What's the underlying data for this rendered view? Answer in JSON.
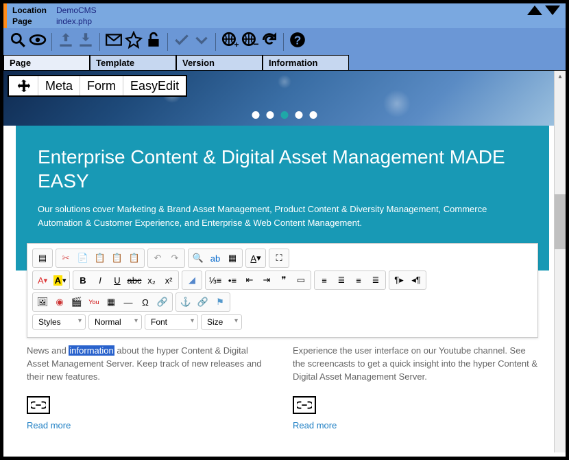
{
  "topbar": {
    "location_label": "Location",
    "location_value": "DemoCMS",
    "page_label": "Page",
    "page_value": "index.php"
  },
  "tabs": [
    "Page",
    "Template",
    "Version",
    "Information"
  ],
  "active_tab": 0,
  "page_tabs": {
    "meta": "Meta",
    "form": "Form",
    "easyedit": "EasyEdit"
  },
  "hero": {
    "dots": 5,
    "active_dot": 2
  },
  "teal": {
    "title": "Enterprise Content & Digital Asset Management MADE EASY",
    "body": "Our solutions cover Marketing & Brand Asset Management, Product Content & Diversity Management, Commerce Automation & Customer Experience, and Enterprise & Web Content Management."
  },
  "editor_dropdowns": {
    "styles": "Styles",
    "format": "Normal",
    "font": "Font",
    "size": "Size"
  },
  "col_left": {
    "pre": "News and ",
    "hl": "information",
    "post": " about the hyper Content & Digital Asset Management Server. Keep track of new releases and their new features.",
    "readmore": "Read more"
  },
  "col_right": {
    "text": "Experience the user interface on our Youtube channel. See the screencasts to get a quick insight into the hyper Content & Digital Asset Management Server.",
    "readmore": "Read more"
  }
}
